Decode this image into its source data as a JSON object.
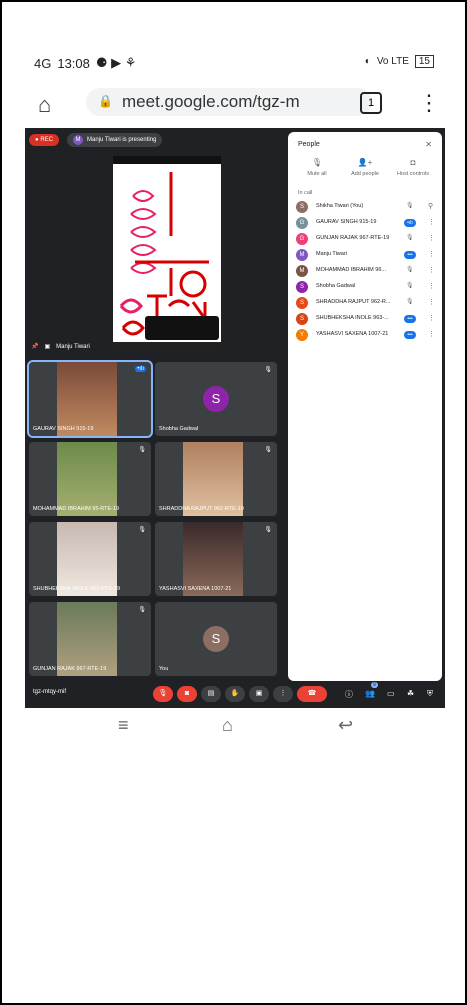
{
  "status": {
    "network": "4G",
    "time": "13:08",
    "right_text": "Vo LTE",
    "battery": "15"
  },
  "browser": {
    "url": "meet.google.com/tgz-m",
    "tabs": "1"
  },
  "meet": {
    "rec": "REC",
    "presenter_initial": "M",
    "presenting": "Manju Tiwari is presenting",
    "presenter_label": "Manju Tiwari",
    "code": "tgz-mtqy-mif",
    "tiles": [
      {
        "name": "GAURAV SINGH 915-19"
      },
      {
        "name": "Shobha Gadwal",
        "initial": "S"
      },
      {
        "name": "MOHAMMAD IBRAHIM 95-RTE-19"
      },
      {
        "name": "SHRADDHA RAJPUT 962-RTE-19"
      },
      {
        "name": "SHUBHEKSHA INOLE 963-RTE-19"
      },
      {
        "name": "YASHASVI SAXENA 1007-21"
      },
      {
        "name": "GUNJAN RAJAK 967-RTE-19"
      },
      {
        "name": "You",
        "initial": "S"
      }
    ],
    "people": {
      "title": "People",
      "mute_all": "Mute all",
      "add_people": "Add people",
      "host_controls": "Host controls",
      "in_call": "In call",
      "list": [
        {
          "initial": "S",
          "name": "Shikha Tiwari (You)",
          "color": "#8d6e63"
        },
        {
          "initial": "G",
          "name": "GAURAV SINGH 915-19",
          "color": "#78909c"
        },
        {
          "initial": "G",
          "name": "GUNJAN RAJAK 967-RTE-19",
          "color": "#ec407a"
        },
        {
          "initial": "M",
          "name": "Manju Tiwari",
          "color": "#7e57c2"
        },
        {
          "initial": "M",
          "name": "MOHAMMAD IBRAHIM 96...",
          "color": "#795548"
        },
        {
          "initial": "S",
          "name": "Shobha Gadwal",
          "color": "#8e24aa"
        },
        {
          "initial": "S",
          "name": "SHRADDHA RAJPUT 962-R...",
          "color": "#e64a19"
        },
        {
          "initial": "S",
          "name": "SHUBHEKSHA INOLE 963-...",
          "color": "#d84315"
        },
        {
          "initial": "Y",
          "name": "YASHASVI SAXENA 1007-21",
          "color": "#f57c00"
        }
      ]
    },
    "participant_count": "9"
  }
}
